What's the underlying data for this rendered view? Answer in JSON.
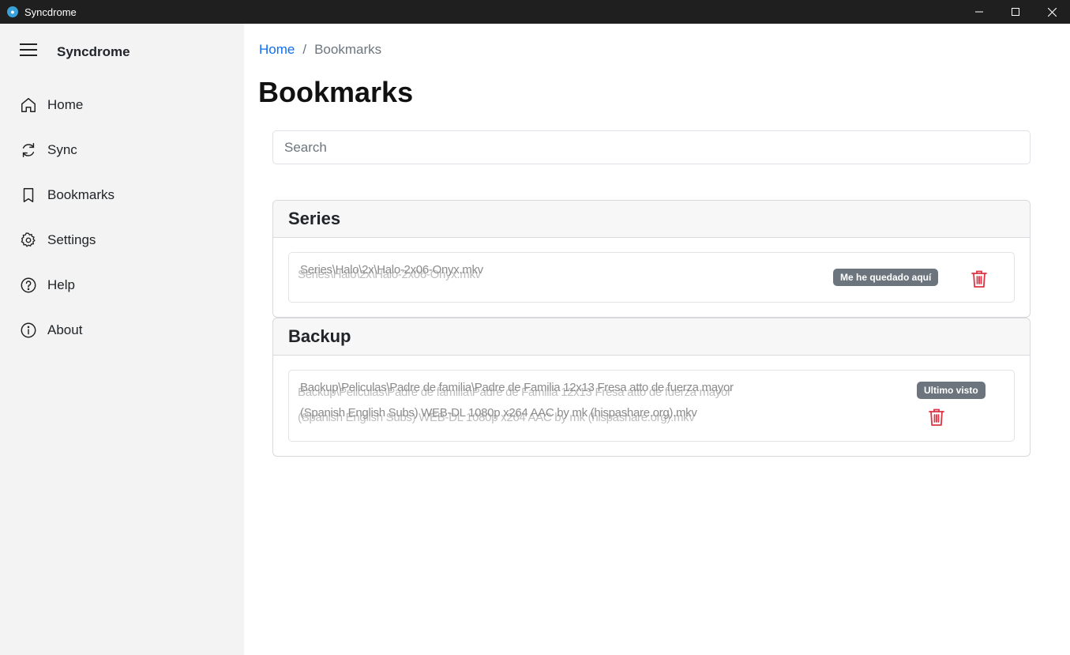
{
  "window": {
    "title": "Syncdrome",
    "icon": "app-logo-icon"
  },
  "sidebar": {
    "app_name": "Syncdrome",
    "items": [
      {
        "label": "Home",
        "icon": "home-icon"
      },
      {
        "label": "Sync",
        "icon": "sync-icon"
      },
      {
        "label": "Bookmarks",
        "icon": "bookmark-icon"
      },
      {
        "label": "Settings",
        "icon": "gear-icon"
      },
      {
        "label": "Help",
        "icon": "help-icon"
      },
      {
        "label": "About",
        "icon": "info-icon"
      }
    ]
  },
  "breadcrumb": {
    "home": "Home",
    "separator": "/",
    "current": "Bookmarks"
  },
  "page": {
    "title": "Bookmarks"
  },
  "search": {
    "placeholder": "Search",
    "value": ""
  },
  "groups": [
    {
      "title": "Series",
      "items": [
        {
          "path": "Series\\Halo\\2x\\Halo-2x06-Onyx.mkv",
          "badge": "Me he quedado aquí"
        }
      ]
    },
    {
      "title": "Backup",
      "items": [
        {
          "path": "Backup\\Peliculas\\Padre de familia\\Padre de Familia 12x13 Fresa atto de fuerza mayor",
          "path2": "(Spanish English Subs) WEB-DL 1080p x264 AAC by mk (hispashare.org).mkv",
          "badge": "Ultimo visto"
        }
      ]
    }
  ],
  "colors": {
    "accent": "#0d6efd",
    "danger": "#dc3545",
    "badge": "#6c757d"
  }
}
